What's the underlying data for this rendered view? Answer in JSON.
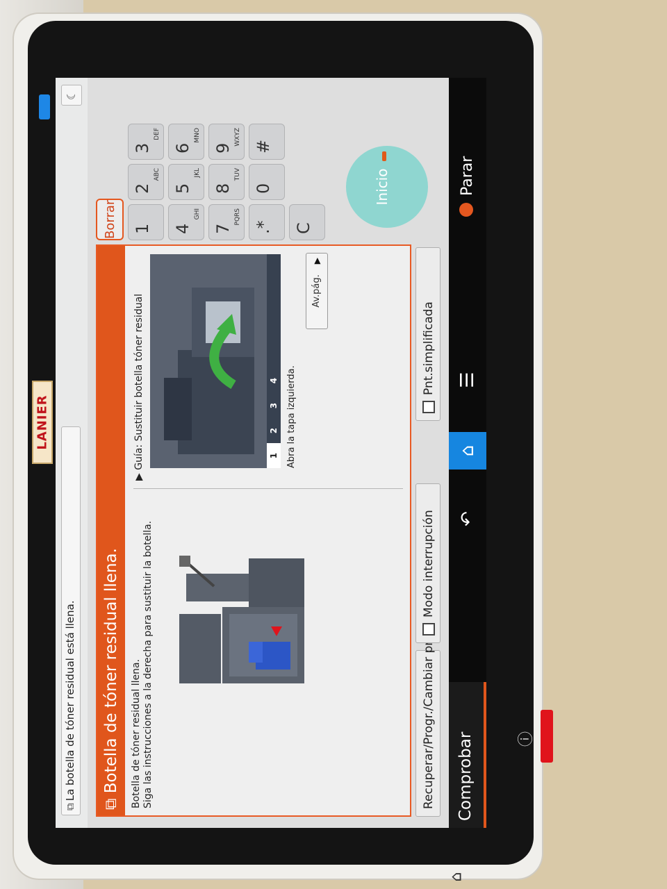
{
  "device": {
    "brand": "LANIER"
  },
  "status_bar": {
    "notice_icon": "toner-bottle-icon",
    "notice": "La botella de tóner residual está llena.",
    "sleep_icon": "moon-icon"
  },
  "dialog": {
    "title": "Botella de tóner residual llena.",
    "message_line1": "Botella de tóner residual llena.",
    "message_line2": "Siga las instrucciones a la derecha para sustituir la botella.",
    "guide_title": "Guía: Sustituir botella tóner residual",
    "steps": [
      "1",
      "2",
      "3",
      "4"
    ],
    "current_step": 1,
    "instruction": "Abra la tapa izquierda.",
    "next_page_label": "Av.pág."
  },
  "keypad": {
    "clear_label": "Borrar",
    "keys": [
      {
        "digit": "1",
        "letters": ""
      },
      {
        "digit": "2",
        "letters": "ABC"
      },
      {
        "digit": "3",
        "letters": "DEF"
      },
      {
        "digit": "4",
        "letters": "GHI"
      },
      {
        "digit": "5",
        "letters": "JKL"
      },
      {
        "digit": "6",
        "letters": "MNO"
      },
      {
        "digit": "7",
        "letters": "PQRS"
      },
      {
        "digit": "8",
        "letters": "TUV"
      },
      {
        "digit": "9",
        "letters": "WXYZ"
      },
      {
        "digit": ".*",
        "letters": ""
      },
      {
        "digit": "0",
        "letters": ""
      },
      {
        "digit": "#",
        "letters": ""
      },
      {
        "digit": "C",
        "letters": ""
      }
    ],
    "start_label": "Inicio"
  },
  "bottom_buttons": {
    "recall_program": "Recuperar/Progr./Cambiar progr.",
    "interrupt_mode": "Modo interrupción",
    "simplified_screen": "Pnt.simplificada"
  },
  "navbar": {
    "check_status": "Comprobar estado",
    "stop_label": "Parar"
  },
  "colors": {
    "accent": "#e0561c",
    "home": "#1686e0",
    "start": "#8fd6d0"
  }
}
